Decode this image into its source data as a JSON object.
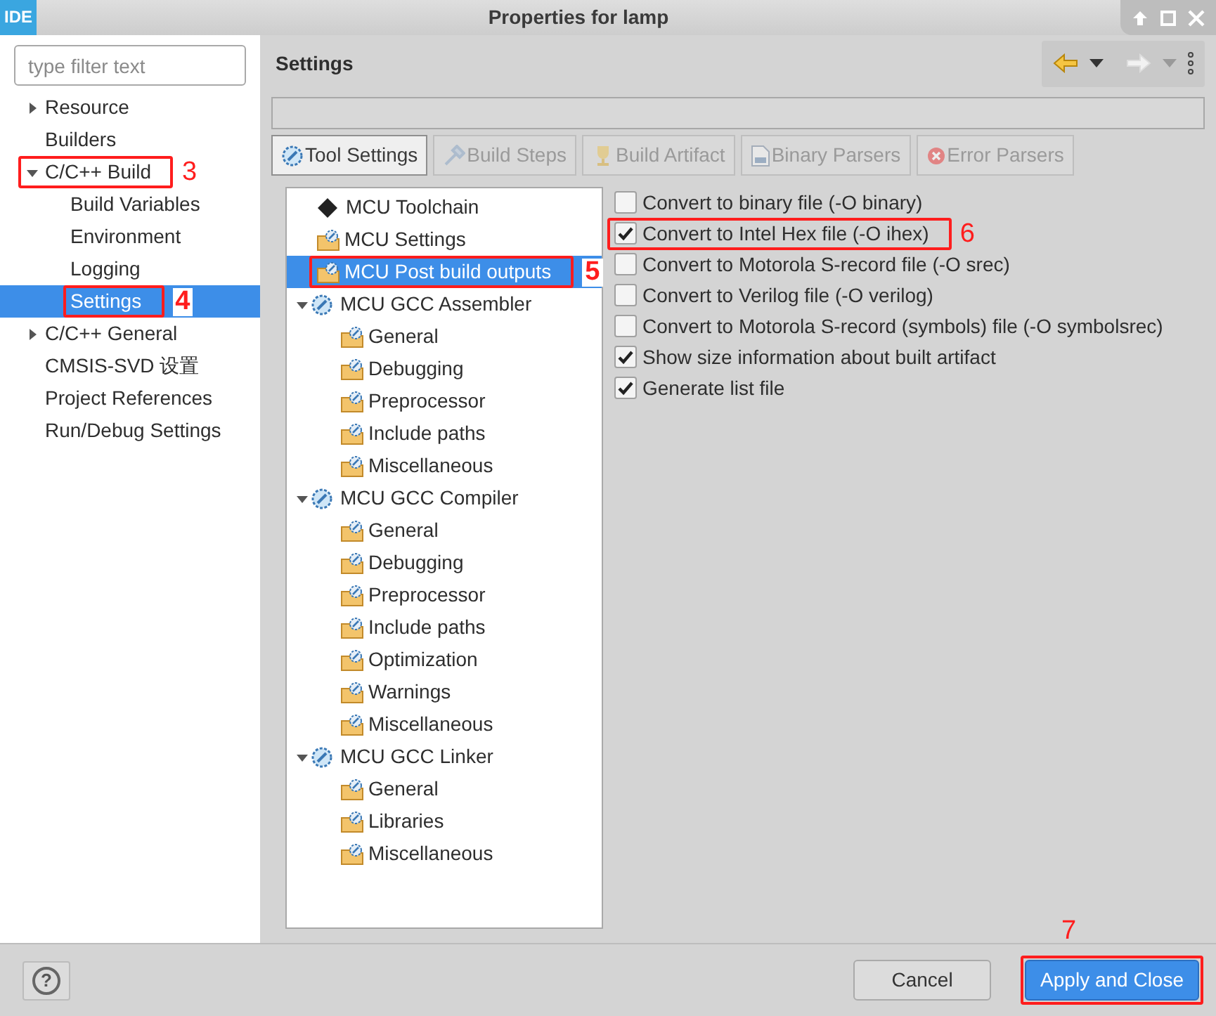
{
  "window": {
    "logo": "IDE",
    "title": "Properties for lamp"
  },
  "filter": {
    "placeholder": "type filter text"
  },
  "nav_tree": [
    {
      "label": "Resource",
      "expanded": false,
      "selected": false
    },
    {
      "label": "Builders",
      "selected": false
    },
    {
      "label": "C/C++ Build",
      "expanded": true,
      "selected": false,
      "annotation": "3",
      "children": [
        {
          "label": "Build Variables",
          "selected": false
        },
        {
          "label": "Environment",
          "selected": false
        },
        {
          "label": "Logging",
          "selected": false
        },
        {
          "label": "Settings",
          "selected": true,
          "annotation": "4"
        }
      ]
    },
    {
      "label": "C/C++ General",
      "expanded": false,
      "selected": false
    },
    {
      "label": "CMSIS-SVD 设置",
      "selected": false
    },
    {
      "label": "Project References",
      "selected": false
    },
    {
      "label": "Run/Debug Settings",
      "selected": false
    }
  ],
  "page": {
    "title": "Settings"
  },
  "toolbar": [
    {
      "kind": "back",
      "disabled": false
    },
    {
      "kind": "dropdown",
      "disabled": false
    },
    {
      "kind": "forward",
      "disabled": true
    },
    {
      "kind": "dropdown",
      "disabled": true
    },
    {
      "kind": "menu",
      "disabled": false
    }
  ],
  "tabs": [
    {
      "label": "Tool Settings",
      "kind": "tool",
      "selected": true,
      "disabled": false
    },
    {
      "label": "Build Steps",
      "kind": "steps",
      "selected": false,
      "disabled": true
    },
    {
      "label": "Build Artifact",
      "kind": "artifact",
      "selected": false,
      "disabled": true
    },
    {
      "label": "Binary Parsers",
      "kind": "binary",
      "selected": false,
      "disabled": true
    },
    {
      "label": "Error Parsers",
      "kind": "error",
      "selected": false,
      "disabled": true
    }
  ],
  "tool_tree": [
    {
      "label": "MCU Toolchain",
      "kind": "chip",
      "selected": false
    },
    {
      "label": "MCU Settings",
      "kind": "folder",
      "selected": false
    },
    {
      "label": "MCU Post build outputs",
      "kind": "folder",
      "selected": true,
      "annotation": "5"
    },
    {
      "label": "MCU GCC Assembler",
      "kind": "tool",
      "selected": false,
      "expanded": true,
      "children": [
        {
          "label": "General",
          "kind": "folder",
          "selected": false
        },
        {
          "label": "Debugging",
          "kind": "folder",
          "selected": false
        },
        {
          "label": "Preprocessor",
          "kind": "folder",
          "selected": false
        },
        {
          "label": "Include paths",
          "kind": "folder",
          "selected": false
        },
        {
          "label": "Miscellaneous",
          "kind": "folder",
          "selected": false
        }
      ]
    },
    {
      "label": "MCU GCC Compiler",
      "kind": "tool",
      "selected": false,
      "expanded": true,
      "children": [
        {
          "label": "General",
          "kind": "folder",
          "selected": false
        },
        {
          "label": "Debugging",
          "kind": "folder",
          "selected": false
        },
        {
          "label": "Preprocessor",
          "kind": "folder",
          "selected": false
        },
        {
          "label": "Include paths",
          "kind": "folder",
          "selected": false
        },
        {
          "label": "Optimization",
          "kind": "folder",
          "selected": false
        },
        {
          "label": "Warnings",
          "kind": "folder",
          "selected": false
        },
        {
          "label": "Miscellaneous",
          "kind": "folder",
          "selected": false
        }
      ]
    },
    {
      "label": "MCU GCC Linker",
      "kind": "tool",
      "selected": false,
      "expanded": true,
      "children": [
        {
          "label": "General",
          "kind": "folder",
          "selected": false
        },
        {
          "label": "Libraries",
          "kind": "folder",
          "selected": false
        },
        {
          "label": "Miscellaneous",
          "kind": "folder",
          "selected": false
        }
      ]
    }
  ],
  "options": [
    {
      "label": "Convert to binary file (-O binary)",
      "checked": false
    },
    {
      "label": "Convert to Intel Hex file (-O ihex)",
      "checked": true,
      "annotation": "6"
    },
    {
      "label": "Convert to Motorola S-record file (-O srec)",
      "checked": false
    },
    {
      "label": "Convert to Verilog file (-O verilog)",
      "checked": false
    },
    {
      "label": "Convert to Motorola S-record (symbols) file (-O symbolsrec)",
      "checked": false
    },
    {
      "label": "Show size information about built artifact",
      "checked": true
    },
    {
      "label": "Generate list file",
      "checked": true
    }
  ],
  "help_button": {
    "label": "?"
  },
  "buttons": [
    {
      "label": "Cancel",
      "kind": "default"
    },
    {
      "label": "Apply and Close",
      "kind": "primary",
      "annotation": "7"
    }
  ]
}
